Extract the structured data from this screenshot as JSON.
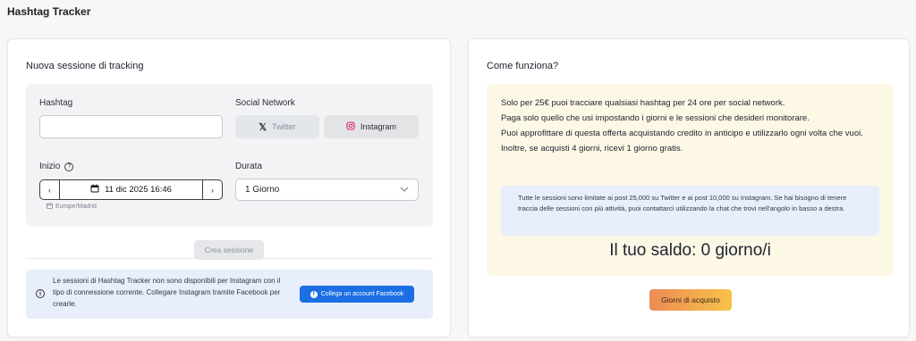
{
  "app": {
    "title": "Hashtag Tracker"
  },
  "left_card": {
    "title": "Nuova sessione di tracking",
    "hashtag": {
      "label": "Hashtag",
      "value": "",
      "placeholder": ""
    },
    "social_network": {
      "label": "Social Network",
      "options": [
        {
          "label": "Twitter",
          "icon": "x-icon",
          "selected": false
        },
        {
          "label": "Instagram",
          "icon": "instagram-icon",
          "selected": true
        }
      ]
    },
    "start": {
      "label": "Inizio",
      "help_icon": "question-circle-icon",
      "date_value": "11 dic 2025 16:46",
      "prev_symbol": "‹",
      "next_symbol": "›",
      "timezone": "Europe/Madrid"
    },
    "duration": {
      "label": "Durata",
      "selected": "1 Giorno"
    },
    "create_button": "Crea sessione",
    "info": {
      "text": "Le sessioni di Hashtag Tracker non sono disponibili per Instagram con il tipo di connessione corrente. Collegare Instagram tramite Facebook per crearle.",
      "button": "Collega un account Facebook"
    }
  },
  "right_card": {
    "title": "Come funziona?",
    "lines": [
      "Solo per 25€ puoi tracciare qualsiasi hashtag per 24 ore per social network.",
      "Paga solo quello che usi impostando i giorni e le sessioni che desideri monitorare.",
      "Puoi approfittare di questa offerta acquistando credito in anticipo e utilizzarlo ogni volta che vuoi.",
      "Inoltre, se acquisti 4 giorni, ricevi 1 giorno gratis."
    ],
    "notice": "Tutte le sessioni sono limitate ai post 25,000 su Twitter e ai post 10,000 su Instagram. Se hai bisogno di tenere traccia delle sessioni con più attività, puoi contattarci utilizzando la chat che trovi nell'angolo in basso a destra.",
    "balance": "Il tuo saldo: 0 giorno/i",
    "buy_button": "Giorni di acquisto"
  },
  "colors": {
    "background": "#f7f7f8",
    "accent_blue": "#1b6fe3",
    "info_bg": "#e8eefb",
    "how_bg": "#fdf7e6",
    "buy_gradient_start": "#ed8a55",
    "buy_gradient_end": "#f7c34a"
  }
}
